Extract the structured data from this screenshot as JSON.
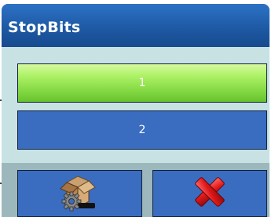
{
  "dialog": {
    "title": "StopBits"
  },
  "options": [
    {
      "label": "1",
      "selected": true
    },
    {
      "label": "2",
      "selected": false
    }
  ],
  "toolbar": {
    "ok_icon": "gear-box-icon",
    "cancel_icon": "red-x-icon"
  },
  "colors": {
    "title_bar": "#1e5aa5",
    "selected_option": "#aef268",
    "option": "#3a6cc0",
    "panel": "#c8e2e4",
    "toolbar": "#9db8bc",
    "cancel_x": "#e01818"
  }
}
